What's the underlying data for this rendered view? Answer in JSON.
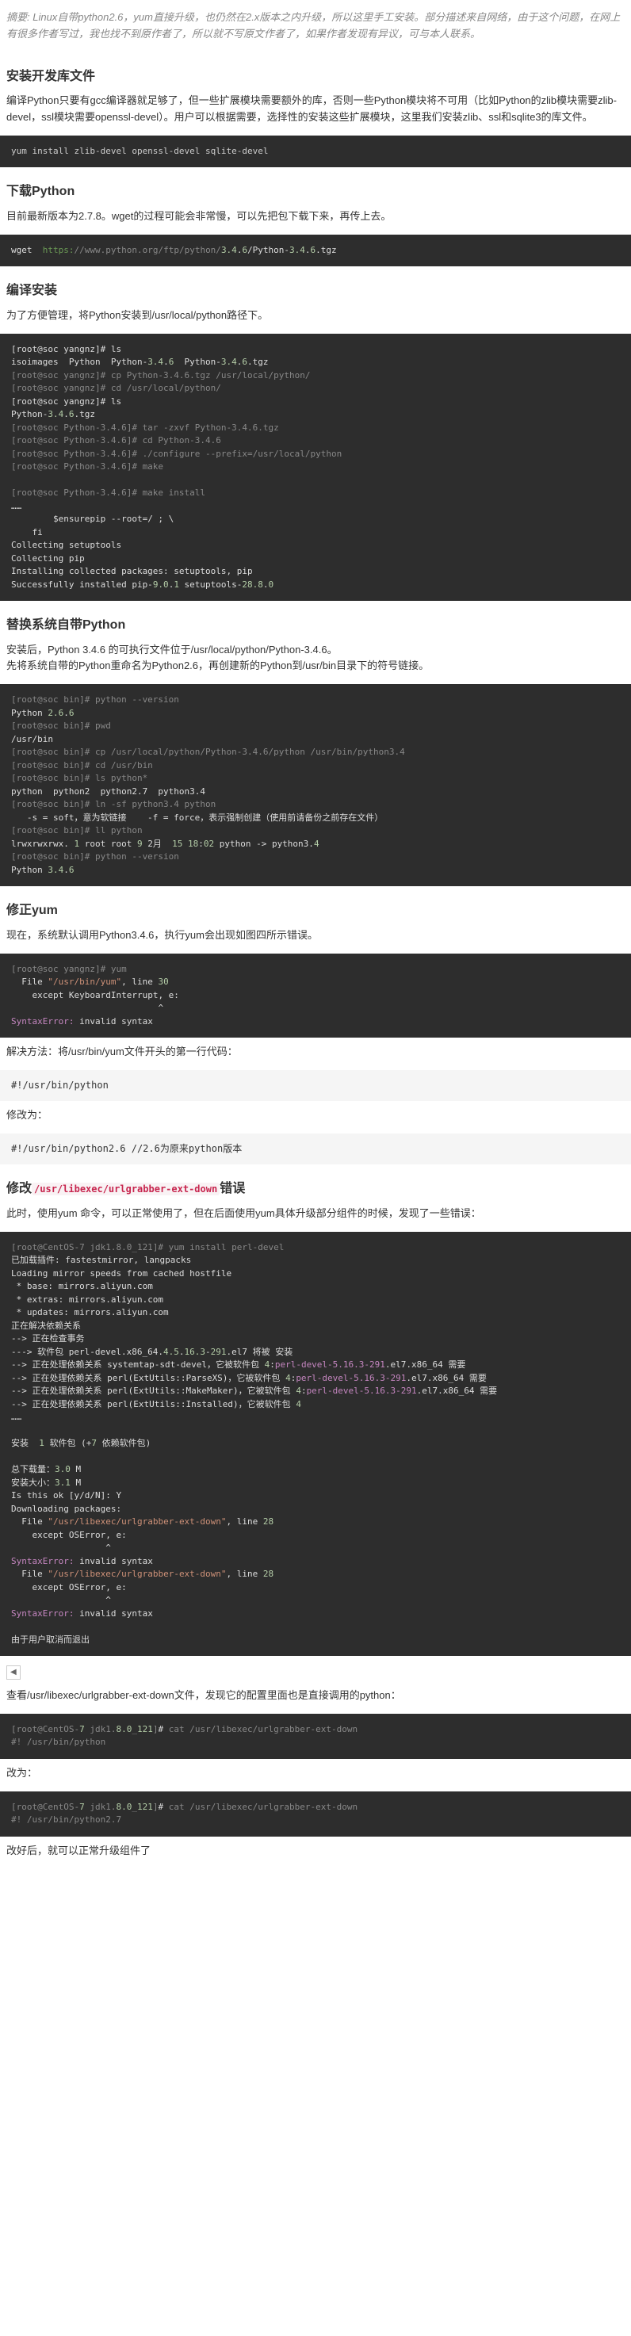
{
  "intro": "摘要: Linux自带python2.6，yum直接升级，也仍然在2.x版本之内升级，所以这里手工安装。部分描述来自网络，由于这个问题，在网上有很多作者写过，我也找不到原作者了，所以就不写原文作者了，如果作者发现有异议，可与本人联系。",
  "s1": {
    "title": "安装开发库文件",
    "p": "编译Python只要有gcc编译器就足够了，但一些扩展模块需要额外的库，否则一些Python模块将不可用（比如Python的zlib模块需要zlib-devel，ssl模块需要openssl-devel）。用户可以根据需要，选择性的安装这些扩展模块，这里我们安装zlib、ssl和sqlite3的库文件。",
    "code": "yum install zlib-devel openssl-devel sqlite-devel"
  },
  "s2": {
    "title": "下载Python",
    "p": "目前最新版本为2.7.8。wget的过程可能会非常慢，可以先把包下载下来，再传上去。",
    "c1": "wget  ",
    "c2": "https:",
    "c3": "//www.python.org/ftp/python/",
    "c4": "3.4",
    "c5": ".",
    "c6": "6",
    "c7": "/Python-",
    "c8": "3.4",
    "c9": ".",
    "c10": "6",
    "c11": ".tgz"
  },
  "s3": {
    "title": "编译安装",
    "p": "为了方便管理，将Python安装到/usr/local/python路径下。",
    "l1": "[root@soc yangnz]# ls",
    "l2": "isoimages  Python  Python-3.4.6  Python-3.4.6.tgz",
    "l3": "[root@soc yangnz]# cp Python-3.4.6.tgz /usr/local/python/",
    "l4": "[root@soc yangnz]# cd /usr/local/python/",
    "l5": "[root@soc yangnz]# ls",
    "l6": "Python-3.4.6.tgz",
    "l7": "[root@soc Python-3.4.6]# tar -zxvf Python-3.4.6.tgz",
    "l8": "[root@soc Python-3.4.6]# cd Python-3.4.6",
    "l9": "[root@soc Python-3.4.6]# ./configure --prefix=/usr/local/python",
    "l10": "[root@soc Python-3.4.6]# make",
    "l11": " ",
    "l12": "[root@soc Python-3.4.6]# make install",
    "l13": "……",
    "l14": "        $ensurepip --root=/ ; \\",
    "l15": "    fi",
    "l16": "Collecting setuptools",
    "l17": "Collecting pip",
    "l18": "Installing collected packages: setuptools, pip",
    "l19": "Successfully installed pip-9.0.1 setuptools-28.8.0"
  },
  "s4": {
    "title": "替换系统自带Python",
    "p": "安装后，Python 3.4.6 的可执行文件位于/usr/local/python/Python-3.4.6。\n先将系统自带的Python重命名为Python2.6，再创建新的Python到/usr/bin目录下的符号链接。",
    "l1": "[root@soc bin]# python --version",
    "l2": "Python 2.6.6",
    "l3": "[root@soc bin]# pwd",
    "l4": "/usr/bin",
    "l5": "[root@soc bin]# cp /usr/local/python/Python-3.4.6/python /usr/bin/python3.4",
    "l6": "[root@soc bin]# cd /usr/bin",
    "l7": "[root@soc bin]# ls python*",
    "l8": "python  python2  python2.7  python3.4",
    "l9": "[root@soc bin]# ln -sf python3.4 python",
    "l10": "   -s = soft，意为软链接    -f = force，表示强制创建（使用前请备份之前存在文件）",
    "l11": "[root@soc bin]# ll python",
    "l12": "lrwxrwxrwx. 1 root root 9 2月  15 18:02 python -> python3.4",
    "l13": "[root@soc bin]# python --version",
    "l14": "Python 3.4.6"
  },
  "s5": {
    "title": "修正yum",
    "p": "现在，系统默认调用Python3.4.6，执行yum会出现如图四所示错误。",
    "c1": "[root@soc yangnz]# yum",
    "c2": "  File \"/usr/bin/yum\", line 30",
    "c3": "    except KeyboardInterrupt, e:",
    "c4": "                            ^",
    "c5": "SyntaxError: invalid syntax",
    "p2": "解决方法：将/usr/bin/yum文件开头的第一行代码：",
    "cl1": "#!/usr/bin/python",
    "p3": "修改为：",
    "cl2": "#!/usr/bin/python2.6    //2.6为原来python版本"
  },
  "s6": {
    "title": "修改/usr/libexec/urlgrabber-ext-down错误",
    "p": "此时，使用yum 命令，可以正常使用了，但在后面使用yum具体升级部分组件的时候，发现了一些错误：",
    "l1": "[root@CentOS-7 jdk1.8.0_121]# yum install perl-devel",
    "l2": "已加载插件: fastestmirror, langpacks",
    "l3": "Loading mirror speeds from cached hostfile",
    "l4": " * base: mirrors.aliyun.com",
    "l5": " * extras: mirrors.aliyun.com",
    "l6": " * updates: mirrors.aliyun.com",
    "l7": "正在解决依赖关系",
    "l8": "--> 正在检查事务",
    "l9": "---> 软件包 perl-devel.x86_64.4.5.16.3-291.el7 将被 安装",
    "l10": "--> 正在处理依赖关系 systemtap-sdt-devel，它被软件包 4:perl-devel-5.16.3-291.el7.x86_64 需要",
    "l11": "--> 正在处理依赖关系 perl(ExtUtils::ParseXS)，它被软件包 4:perl-devel-5.16.3-291.el7.x86_64 需要",
    "l12": "--> 正在处理依赖关系 perl(ExtUtils::MakeMaker)，它被软件包 4:perl-devel-5.16.3-291.el7.x86_64 需要",
    "l13": "--> 正在处理依赖关系 perl(ExtUtils::Installed)，它被软件包 4",
    "l14": "……",
    "l15": " ",
    "l16": "安装  1 软件包 (+7 依赖软件包)",
    "l17": " ",
    "l18": "总下载量：3.0 M",
    "l19": "安装大小：3.1 M",
    "l20": "Is this ok [y/d/N]: Y",
    "l21": "Downloading packages:",
    "l22": "  File \"/usr/libexec/urlgrabber-ext-down\", line 28",
    "l23": "    except OSError, e:",
    "l24": "                  ^",
    "l25": "SyntaxError: invalid syntax",
    "l26": "  File \"/usr/libexec/urlgrabber-ext-down\", line 28",
    "l27": "    except OSError, e:",
    "l28": "                  ^",
    "l29": "SyntaxError: invalid syntax",
    "l30": " ",
    "l31": "由于用户取消而退出",
    "p2": "查看/usr/libexec/urlgrabber-ext-down文件，发现它的配置里面也是直接调用的python：",
    "c1a": "[root@CentOS-7 jdk1.8.0_121]# cat /usr/libexec/urlgrabber-ext-down",
    "c1b": "#! /usr/bin/python",
    "p3": "改为：",
    "c2a": "[root@CentOS-7 jdk1.8.0_121]# cat /usr/libexec/urlgrabber-ext-down",
    "c2b": "#! /usr/bin/python2.7",
    "p4": "改好后，就可以正常升级组件了"
  }
}
